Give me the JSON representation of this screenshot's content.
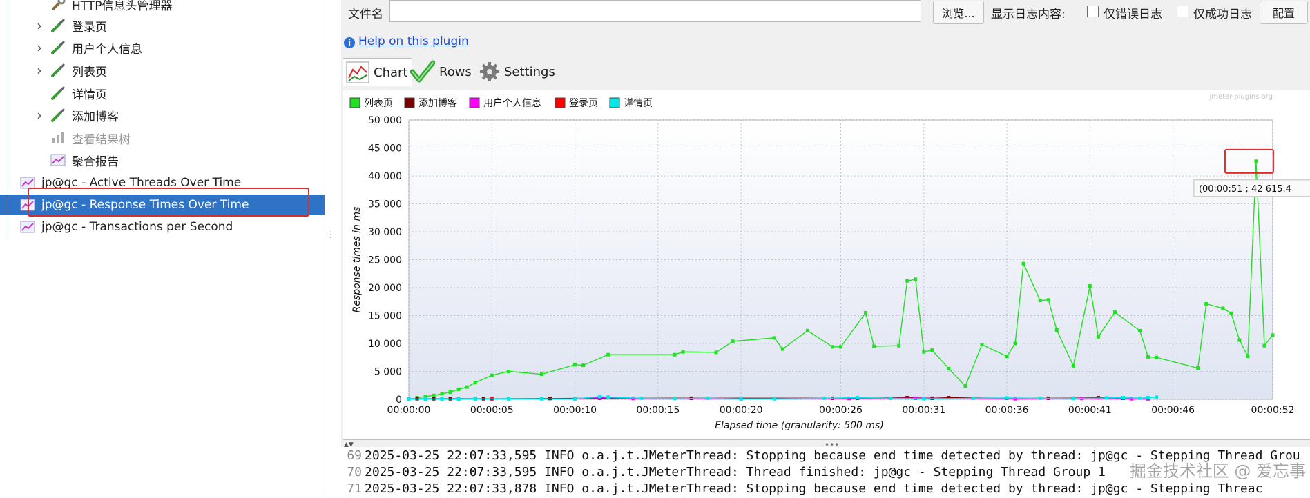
{
  "tree": {
    "items": [
      {
        "label": "HTTP信息头管理器",
        "expandable": false,
        "icon": "wrench-icon"
      },
      {
        "label": "登录页",
        "expandable": true,
        "icon": "pipette-icon"
      },
      {
        "label": "用户个人信息",
        "expandable": true,
        "icon": "pipette-icon"
      },
      {
        "label": "列表页",
        "expandable": true,
        "icon": "pipette-icon"
      },
      {
        "label": "详情页",
        "expandable": false,
        "icon": "pipette-icon"
      },
      {
        "label": "添加博客",
        "expandable": true,
        "icon": "pipette-icon"
      },
      {
        "label": "查看结果树",
        "expandable": false,
        "icon": "listener-icon",
        "disabled": true
      },
      {
        "label": "聚合报告",
        "expandable": false,
        "icon": "graph-icon"
      },
      {
        "label": "jp@gc - Active Threads Over Time",
        "icon": "graph-icon"
      },
      {
        "label": "jp@gc - Response Times Over Time",
        "icon": "graph-icon",
        "selected": true
      },
      {
        "label": "jp@gc - Transactions per Second",
        "icon": "graph-icon"
      }
    ]
  },
  "filebar": {
    "filename_label": "文件名",
    "filename_value": "",
    "browse_button": "浏览...",
    "log_display_label": "显示日志内容:",
    "errors_only_label": "仅错误日志",
    "success_only_label": "仅成功日志",
    "config_button": "配置"
  },
  "help_link": "Help on this plugin",
  "tabs": [
    {
      "label": "Chart",
      "icon": "chart-icon"
    },
    {
      "label": "Rows",
      "icon": "checkmark-icon"
    },
    {
      "label": "Settings",
      "icon": "gear-icon"
    }
  ],
  "chart_data": {
    "type": "line",
    "watermark": "jmeter-plugins.org",
    "ylabel": "Response times in ms",
    "xlabel": "Elapsed time (granularity: 500 ms)",
    "ylim": [
      0,
      50000
    ],
    "yticks": [
      "0",
      "5 000",
      "10 000",
      "15 000",
      "20 000",
      "25 000",
      "30 000",
      "35 000",
      "40 000",
      "45 000",
      "50 000"
    ],
    "xlim": [
      0,
      52
    ],
    "xticks": [
      {
        "t": 0,
        "label": "00:00:00"
      },
      {
        "t": 5,
        "label": "00:00:05"
      },
      {
        "t": 10,
        "label": "00:00:10"
      },
      {
        "t": 15,
        "label": "00:00:15"
      },
      {
        "t": 20,
        "label": "00:00:20"
      },
      {
        "t": 26,
        "label": "00:00:26"
      },
      {
        "t": 31,
        "label": "00:00:31"
      },
      {
        "t": 36,
        "label": "00:00:36"
      },
      {
        "t": 41,
        "label": "00:00:41"
      },
      {
        "t": 46,
        "label": "00:00:46"
      },
      {
        "t": 52,
        "label": "00:00:52"
      }
    ],
    "grid": true,
    "legend_position": "top-left",
    "tooltip": "(00:00:51 ; 42 615.4",
    "series": [
      {
        "name": "列表页",
        "color": "#22e022",
        "points": [
          [
            0.5,
            300
          ],
          [
            1,
            500
          ],
          [
            1.5,
            700
          ],
          [
            2,
            1000
          ],
          [
            2.5,
            1300
          ],
          [
            3,
            1800
          ],
          [
            3.5,
            2200
          ],
          [
            4,
            3000
          ],
          [
            5,
            4300
          ],
          [
            6,
            5000
          ],
          [
            8,
            4500
          ],
          [
            10,
            6200
          ],
          [
            10.5,
            6100
          ],
          [
            12,
            8000
          ],
          [
            16,
            8000
          ],
          [
            16.5,
            8500
          ],
          [
            18.5,
            8400
          ],
          [
            19.5,
            10400
          ],
          [
            22,
            11000
          ],
          [
            22.5,
            9000
          ],
          [
            24,
            12300
          ],
          [
            25.5,
            9400
          ],
          [
            26,
            9400
          ],
          [
            27.5,
            15500
          ],
          [
            28,
            9500
          ],
          [
            29.5,
            9600
          ],
          [
            30,
            21200
          ],
          [
            30.5,
            21500
          ],
          [
            31,
            8500
          ],
          [
            31.5,
            8800
          ],
          [
            32.5,
            5500
          ],
          [
            33.5,
            2400
          ],
          [
            34.5,
            9800
          ],
          [
            36,
            7700
          ],
          [
            36.5,
            10000
          ],
          [
            37,
            24300
          ],
          [
            38,
            17700
          ],
          [
            38.5,
            17800
          ],
          [
            39,
            12400
          ],
          [
            40,
            6000
          ],
          [
            41,
            20300
          ],
          [
            41.5,
            11200
          ],
          [
            42.5,
            15600
          ],
          [
            44,
            12300
          ],
          [
            44.5,
            7600
          ],
          [
            45,
            7500
          ],
          [
            47.5,
            5600
          ],
          [
            48,
            17100
          ],
          [
            49,
            16300
          ],
          [
            49.5,
            15400
          ],
          [
            50,
            10600
          ],
          [
            50.5,
            7700
          ],
          [
            51,
            42615
          ],
          [
            51.5,
            9600
          ],
          [
            52,
            11500
          ]
        ]
      },
      {
        "name": "添加博客",
        "color": "#7a0000",
        "points": [
          [
            0,
            100
          ],
          [
            0.5,
            100
          ],
          [
            1.5,
            100
          ],
          [
            2.5,
            100
          ],
          [
            4.5,
            100
          ],
          [
            8.5,
            150
          ],
          [
            11.5,
            200
          ],
          [
            17,
            200
          ],
          [
            25.5,
            200
          ],
          [
            27,
            200
          ],
          [
            30,
            300
          ],
          [
            31.5,
            200
          ],
          [
            32.5,
            300
          ],
          [
            36,
            200
          ],
          [
            38.5,
            200
          ],
          [
            40,
            200
          ],
          [
            41.5,
            300
          ],
          [
            43,
            200
          ]
        ]
      },
      {
        "name": "用户个人信息",
        "color": "#ff00ff",
        "points": [
          [
            0,
            80
          ],
          [
            5,
            80
          ],
          [
            10,
            100
          ],
          [
            11.5,
            300
          ],
          [
            13.5,
            150
          ],
          [
            20,
            100
          ],
          [
            26.5,
            150
          ],
          [
            30.5,
            200
          ],
          [
            36.5,
            100
          ],
          [
            40.5,
            150
          ],
          [
            43.5,
            100
          ],
          [
            44.5,
            80
          ]
        ]
      },
      {
        "name": "登录页",
        "color": "#ff0000",
        "points": [
          [
            0,
            100
          ],
          [
            1,
            100
          ],
          [
            2,
            100
          ],
          [
            3,
            120
          ],
          [
            4,
            120
          ],
          [
            5,
            100
          ]
        ]
      },
      {
        "name": "详情页",
        "color": "#00e8e8",
        "points": [
          [
            0,
            50
          ],
          [
            1,
            60
          ],
          [
            2,
            60
          ],
          [
            3,
            60
          ],
          [
            4,
            80
          ],
          [
            6,
            80
          ],
          [
            8,
            90
          ],
          [
            10,
            100
          ],
          [
            11.5,
            500
          ],
          [
            12,
            400
          ],
          [
            14,
            200
          ],
          [
            16,
            150
          ],
          [
            18,
            200
          ],
          [
            20,
            100
          ],
          [
            22,
            100
          ],
          [
            25,
            200
          ],
          [
            27,
            300
          ],
          [
            29,
            200
          ],
          [
            31,
            100
          ],
          [
            34,
            200
          ],
          [
            36,
            250
          ],
          [
            38,
            200
          ],
          [
            40,
            150
          ],
          [
            42,
            250
          ],
          [
            43,
            300
          ],
          [
            44,
            200
          ],
          [
            44.5,
            300
          ],
          [
            45,
            400
          ]
        ]
      }
    ]
  },
  "log": [
    {
      "num": "69",
      "text": "2025-03-25 22:07:33,595 INFO o.a.j.t.JMeterThread: Stopping because end time detected by thread: jp@gc - Stepping Thread Grou"
    },
    {
      "num": "70",
      "text": "2025-03-25 22:07:33,595 INFO o.a.j.t.JMeterThread: Thread finished: jp@gc - Stepping Thread Group 1"
    },
    {
      "num": "71",
      "text": "2025-03-25 22:07:33,878 INFO o.a.j.t.JMeterThread: Stopping because end time detected by thread: jp@gc - Stepping Threac"
    }
  ],
  "watermark": "掘金技术社区 @ 爱忘事"
}
